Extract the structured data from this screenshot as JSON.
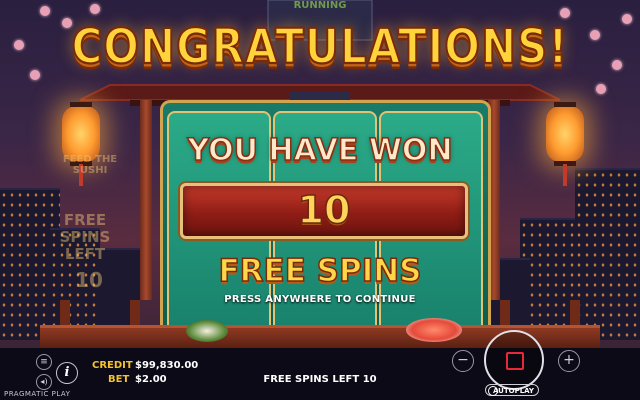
{
  "game": {
    "top_logo": "RUNNING",
    "popup": {
      "headline": "CONGRATULATIONS!",
      "subtitle": "YOU HAVE WON",
      "count": "10",
      "prize": "FREE SPINS",
      "instruction": "PRESS ANYWHERE TO CONTINUE"
    },
    "side_panel": {
      "feature_label": "FEED THE SUSHI",
      "free_spins_label": "FREE SPINS LEFT",
      "free_spins_value": "10"
    }
  },
  "footer": {
    "credit_label": "CREDIT",
    "credit_value": "$99,830.00",
    "bet_label": "BET",
    "bet_value": "$2.00",
    "status": "FREE SPINS LEFT 10",
    "autoplay_label": "AUTOPLAY",
    "brand": "PRAGMATIC PLAY",
    "minus_symbol": "−",
    "plus_symbol": "+",
    "info_symbol": "i",
    "menu_symbol": "≡",
    "sound_symbol": "◂)"
  },
  "colors": {
    "headline": "#ffd43a",
    "prize_box": "#8f1d16",
    "reel_green": "#18806b",
    "credit_label": "#f2c230",
    "stop_button": "#e8283a"
  },
  "icons": [
    "menu-icon",
    "sound-icon",
    "info-icon",
    "minus-icon",
    "plus-icon",
    "stop-icon",
    "autoplay-icon"
  ]
}
